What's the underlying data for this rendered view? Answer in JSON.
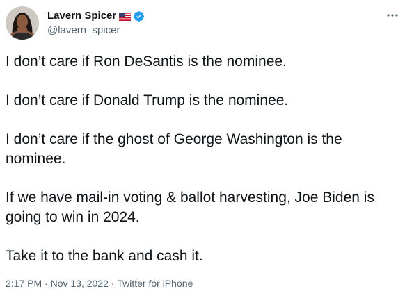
{
  "tweet": {
    "author": {
      "name": "Lavern Spicer",
      "handle": "@lavern_spicer",
      "avatar_icon": "profile-photo",
      "flag_icon": "us-flag-icon",
      "verified_icon": "verified-badge-icon",
      "verified_color": "#1d9bf0"
    },
    "more_icon": "more-options-icon",
    "text": "I don’t care if Ron DeSantis is the nominee.\n\nI don’t care if Donald Trump is the nominee.\n\nI don’t care if the ghost of George Washington is the nominee.\n\nIf we have mail-in voting & ballot harvesting, Joe Biden is going to win in 2024.\n\nTake it to the bank and cash it.",
    "time": "2:17 PM",
    "sep1": " · ",
    "date": "Nov 13, 2022",
    "sep2": " · ",
    "source": "Twitter for iPhone"
  }
}
